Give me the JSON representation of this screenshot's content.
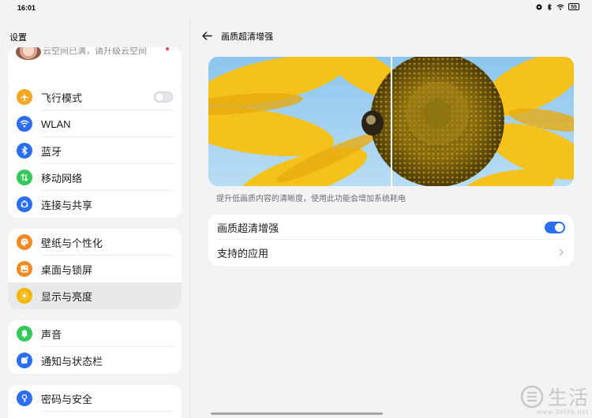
{
  "status_bar": {
    "time": "16:01",
    "battery": "55",
    "icons": [
      "signal-icon",
      "bluetooth-icon",
      "wifi-icon",
      "battery-icon"
    ]
  },
  "sidebar": {
    "title": "设置",
    "account_text": "云空间已满，请升级云空间",
    "groups": [
      [
        {
          "label": "飞行模式",
          "icon": "airplane-icon",
          "color": "#f5a623",
          "toggle": false
        },
        {
          "label": "WLAN",
          "icon": "wifi-icon",
          "color": "#2b6ef4"
        },
        {
          "label": "蓝牙",
          "icon": "bluetooth-icon",
          "color": "#2b6ef4"
        },
        {
          "label": "移动网络",
          "icon": "mobile-data-icon",
          "color": "#34c759"
        },
        {
          "label": "连接与共享",
          "icon": "connection-share-icon",
          "color": "#2b6ef4"
        }
      ],
      [
        {
          "label": "壁纸与个性化",
          "icon": "palette-icon",
          "color": "#f08a24"
        },
        {
          "label": "桌面与锁屏",
          "icon": "desktop-icon",
          "color": "#f08a24"
        },
        {
          "label": "显示与亮度",
          "icon": "brightness-icon",
          "color": "#f7b500",
          "active": true
        }
      ],
      [
        {
          "label": "声音",
          "icon": "bell-icon",
          "color": "#34c759"
        },
        {
          "label": "通知与状态栏",
          "icon": "notification-icon",
          "color": "#2b6ef4"
        }
      ],
      [
        {
          "label": "密码与安全",
          "icon": "lock-icon",
          "color": "#2b6ef4"
        }
      ]
    ]
  },
  "main": {
    "title": "画质超清增强",
    "caption": "提升低画质内容的清晰度，使用此功能会增加系统耗电",
    "rows": [
      {
        "label": "画质超清增强",
        "control": "toggle",
        "on": true
      },
      {
        "label": "支持的应用",
        "control": "chevron"
      }
    ]
  },
  "watermark": {
    "text": "生活",
    "url": "www.3elife.net"
  },
  "colors": {
    "accent": "#2b6ef4",
    "background": "#f1f3f5",
    "card": "#ffffff"
  }
}
